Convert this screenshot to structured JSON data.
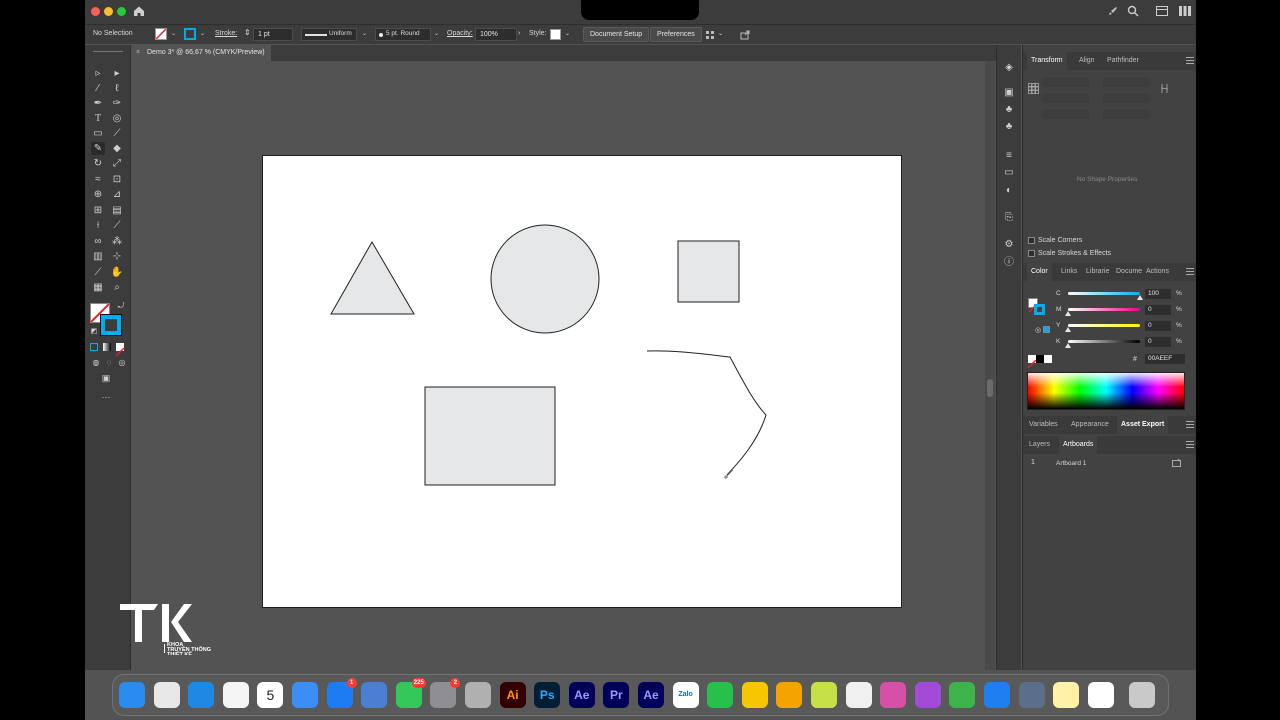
{
  "control_bar": {
    "selection_status": "No Selection",
    "stroke_label": "Stroke:",
    "stroke_weight": "1 pt",
    "profile": "Uniform",
    "brush": "5 pt. Round",
    "opacity_label": "Opacity:",
    "opacity_value": "100%",
    "style_label": "Style:",
    "document_setup_button": "Document Setup",
    "preferences_button": "Preferences"
  },
  "document": {
    "tab_title": "Demo 3* @ 66,67 % (CMYK/Preview)"
  },
  "properties_panel": {
    "tabs": [
      "Transform",
      "Align",
      "Pathfinder"
    ],
    "empty_message": "No Shape Properties",
    "scale_corners": "Scale Corners",
    "scale_strokes": "Scale Strokes & Effects"
  },
  "color_panel": {
    "tabs": [
      "Color",
      "Links",
      "Librarie",
      "Docume",
      "Actions"
    ],
    "channels": [
      {
        "letter": "C",
        "value": "100",
        "unit": "%",
        "level": 1.0,
        "color": "#00aeef"
      },
      {
        "letter": "M",
        "value": "0",
        "unit": "%",
        "level": 0.0,
        "color": "#ec008c"
      },
      {
        "letter": "Y",
        "value": "0",
        "unit": "%",
        "level": 0.0,
        "color": "#fff200"
      },
      {
        "letter": "K",
        "value": "0",
        "unit": "%",
        "level": 0.0,
        "color": "#000000"
      }
    ],
    "hex_symbol": "#",
    "hex_value": "00AEEF"
  },
  "lower_panel": {
    "tabs": [
      "Variables",
      "Appearance",
      "Asset Export"
    ],
    "sub_tabs": [
      "Layers",
      "Artboards"
    ],
    "artboards": [
      {
        "index": "1",
        "name": "Artboard 1"
      }
    ]
  },
  "colors": {
    "fill_swatch": "#00aeef",
    "shape_fill": "#e6e7e8",
    "shape_stroke": "#231f20"
  },
  "dock": {
    "apps": [
      {
        "name": "finder-icon",
        "label": "",
        "color": "#2a8cf0"
      },
      {
        "name": "launchpad-icon",
        "label": "",
        "color": "#e8e8e8"
      },
      {
        "name": "safari-icon",
        "label": "",
        "color": "#1e88e5"
      },
      {
        "name": "photos-icon",
        "label": "",
        "color": "#f5f5f5"
      },
      {
        "name": "calendar-icon",
        "label": "5",
        "color": "#ffffff"
      },
      {
        "name": "mail-icon",
        "label": "",
        "color": "#3a8ef5"
      },
      {
        "name": "app-store-icon",
        "label": "",
        "color": "#1c7cf4",
        "badge": "1"
      },
      {
        "name": "files-icon",
        "label": "",
        "color": "#4a7fd4"
      },
      {
        "name": "messages-icon",
        "label": "",
        "color": "#34c759",
        "badge": "225"
      },
      {
        "name": "system-settings-icon",
        "label": "",
        "color": "#8e8e93",
        "badge": "2"
      },
      {
        "name": "printer-icon",
        "label": "",
        "color": "#b0b0b0"
      },
      {
        "name": "illustrator-icon",
        "label": "Ai",
        "color": "#330000",
        "text_color": "#ff9a00"
      },
      {
        "name": "photoshop-icon",
        "label": "Ps",
        "color": "#001e36",
        "text_color": "#31a8ff"
      },
      {
        "name": "after-effects-icon",
        "label": "Ae",
        "color": "#00005b",
        "text_color": "#9999ff"
      },
      {
        "name": "premiere-icon",
        "label": "Pr",
        "color": "#00005b",
        "text_color": "#9999ff"
      },
      {
        "name": "after-effects-2-icon",
        "label": "Ae",
        "color": "#00005b",
        "text_color": "#9999ff"
      },
      {
        "name": "zalo-icon",
        "label": "Zalo",
        "color": "#ffffff",
        "text_color": "#0068ff"
      },
      {
        "name": "numbers-icon",
        "label": "",
        "color": "#27c04a"
      },
      {
        "name": "tips-icon",
        "label": "",
        "color": "#f7c600"
      },
      {
        "name": "vpn-icon",
        "label": "",
        "color": "#f4a300"
      },
      {
        "name": "chat-app-icon",
        "label": "",
        "color": "#c6e048"
      },
      {
        "name": "gemini-icon",
        "label": "",
        "color": "#f0f0f0"
      },
      {
        "name": "pink-app-icon",
        "label": "",
        "color": "#d84fa8"
      },
      {
        "name": "podcast-icon",
        "label": "",
        "color": "#a34bd8"
      },
      {
        "name": "green-app-icon",
        "label": "",
        "color": "#3cb44a"
      },
      {
        "name": "q-app-icon",
        "label": "",
        "color": "#1e7ff0"
      },
      {
        "name": "db-app-icon",
        "label": "",
        "color": "#5c6f8a"
      },
      {
        "name": "notes-icon",
        "label": "",
        "color": "#fff2a8"
      },
      {
        "name": "capcut-icon",
        "label": "",
        "color": "#ffffff"
      },
      {
        "name": "trash-icon",
        "label": "",
        "color": "#c9c9c9"
      }
    ]
  }
}
